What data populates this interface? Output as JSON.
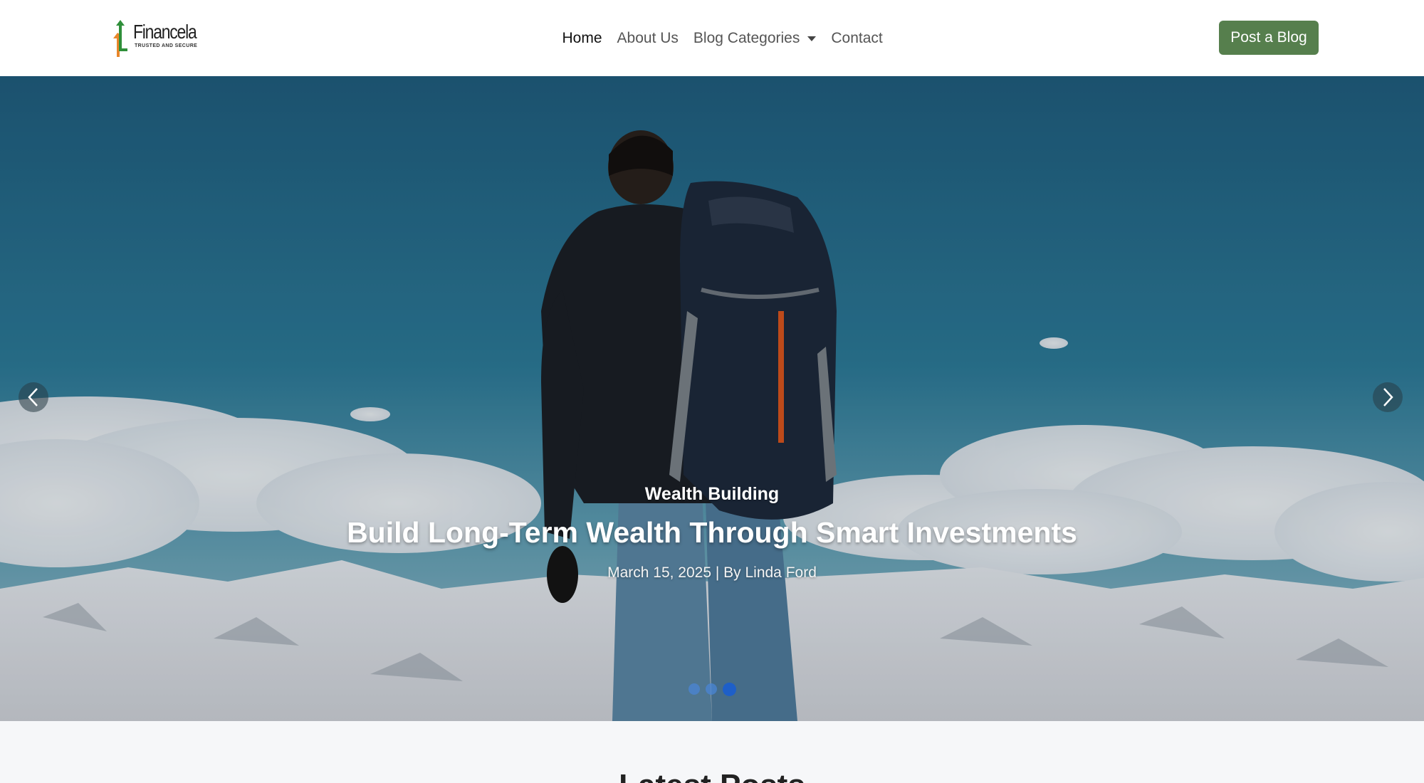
{
  "brand": {
    "name": "Financela",
    "tagline": "TRUSTED AND SECURE",
    "colors": {
      "orange": "#e8862a",
      "green": "#2f8f3a"
    }
  },
  "nav": {
    "items": [
      {
        "label": "Home",
        "active": true
      },
      {
        "label": "About Us",
        "active": false
      },
      {
        "label": "Blog Categories",
        "active": false,
        "dropdown": true
      },
      {
        "label": "Contact",
        "active": false
      }
    ],
    "cta_label": "Post a Blog",
    "cta_color": "#567f4d"
  },
  "hero": {
    "category": "Wealth Building",
    "title": "Build Long-Term Wealth Through Smart Investments",
    "meta": "March 15, 2025 | By Linda Ford",
    "prev_icon": "chevron-left-icon",
    "next_icon": "chevron-right-icon",
    "slide_count": 3,
    "active_slide": 3
  },
  "latest": {
    "heading": "Latest Posts"
  }
}
